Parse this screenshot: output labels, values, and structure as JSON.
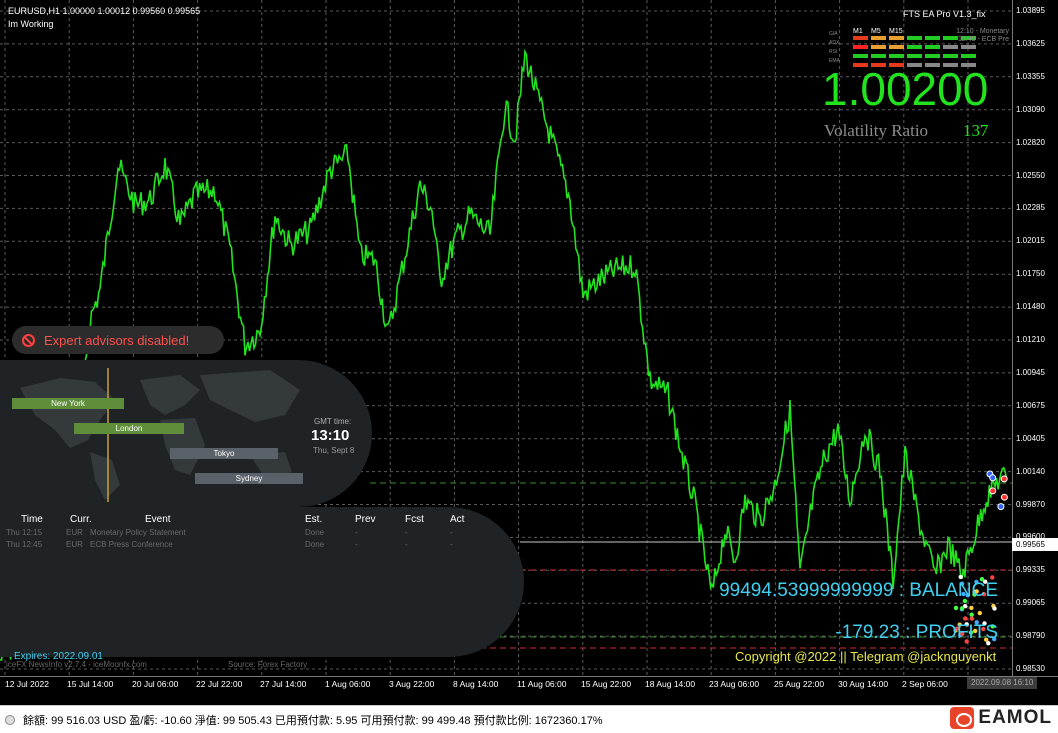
{
  "chart": {
    "symbol_title": "EURUSD,H1  1.00000 1.00012 0.99560 0.99565",
    "status_text": "Im Working",
    "ea_name": "FTS EA Pro V1.3_fix",
    "big_price": "1.00200",
    "volatility_label": "Volatility Ratio",
    "volatility_value": "137",
    "balance_text": "99494.53999999999 : BALANCE",
    "profit_text": "-179.23 : PROFITS",
    "copyright": "Copyright @2022 || Telegram @jacknguyenkt",
    "current_price_marker": "0.99565",
    "time_marker": "2022.09.08 16:10"
  },
  "ea_banner": {
    "text": "Expert advisors disabled!"
  },
  "indicator_grid": {
    "row_labels": [
      "GIA",
      "ADX",
      "RSI",
      "EMA"
    ],
    "timeframes": [
      "M1",
      "M5",
      "M15"
    ],
    "right_labels": [
      "12:10 - Monetary",
      "12:45 - ECB Pre"
    ]
  },
  "sessions_panel": {
    "sessions": [
      "New York",
      "London",
      "Tokyo",
      "Sydney"
    ],
    "gmt_label": "GMT time:",
    "gmt_time": "13:10",
    "gmt_date": "Thu, Sept 8"
  },
  "news_panel": {
    "headers": [
      "Time",
      "Curr.",
      "Event",
      "Est.",
      "Prev",
      "Fcst",
      "Act"
    ],
    "rows": [
      [
        "Thu 12:15",
        "EUR",
        "Monetary Policy Statement",
        "Done",
        "-",
        "-",
        "-"
      ],
      [
        "Thu 12:45",
        "EUR",
        "ECB Press Conference",
        "Done",
        "-",
        "-",
        "-"
      ]
    ],
    "footer_left": "Expires: 2022.09.01",
    "footer_small": "iceFX NewsInfo v2.7.4 - iceMoonfx.com",
    "footer_source": "Source: Forex Factory"
  },
  "price_axis": [
    "1.03895",
    "1.03625",
    "1.03355",
    "1.03090",
    "1.02820",
    "1.02550",
    "1.02285",
    "1.02015",
    "1.01750",
    "1.01480",
    "1.01210",
    "1.00945",
    "1.00675",
    "1.00405",
    "1.00140",
    "0.99870",
    "0.99600",
    "0.99335",
    "0.99065",
    "0.98790",
    "0.98530"
  ],
  "time_axis": [
    "12 Jul 2022",
    "15 Jul 14:00",
    "20 Jul 06:00",
    "22 Jul 22:00",
    "27 Jul 14:00",
    "1 Aug 06:00",
    "3 Aug 22:00",
    "8 Aug 14:00",
    "11 Aug 06:00",
    "15 Aug 22:00",
    "18 Aug 14:00",
    "23 Aug 06:00",
    "25 Aug 22:00",
    "30 Aug 14:00",
    "2 Sep 06:00"
  ],
  "status_bar": {
    "text": "餘額: 99 516.03 USD  盈/虧: -10.60  淨值: 99 505.43  已用預付款: 5.95  可用預付款: 99 499.48  預付款比例: 1672360.17%"
  },
  "brand": {
    "name": "EAMOL",
    "icon": "eamol-logo-icon"
  },
  "colors": {
    "candles": "#22e41e",
    "grid": "#5a5a5a",
    "accent_cyan": "#3fd0f0",
    "copyright": "#e8e84a"
  }
}
